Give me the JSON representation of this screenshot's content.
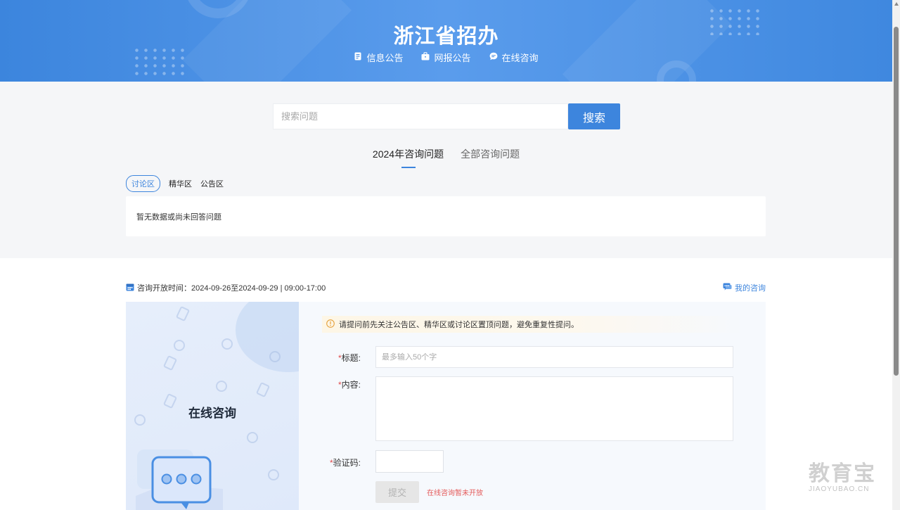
{
  "header": {
    "title": "浙江省招办",
    "nav": [
      {
        "label": "信息公告",
        "icon": "document-icon"
      },
      {
        "label": "网报公告",
        "icon": "briefcase-icon"
      },
      {
        "label": "在线咨询",
        "icon": "chat-bubble-icon"
      }
    ]
  },
  "search": {
    "placeholder": "搜索问题",
    "button_label": "搜索"
  },
  "tabs": [
    {
      "label": "2024年咨询问题",
      "active": true
    },
    {
      "label": "全部咨询问题",
      "active": false
    }
  ],
  "sections": [
    {
      "label": "讨论区",
      "active": true
    },
    {
      "label": "精华区",
      "active": false
    },
    {
      "label": "公告区",
      "active": false
    }
  ],
  "question_list": {
    "empty_text": "暂无数据或尚未回答问题"
  },
  "consult": {
    "open_time": "咨询开放时间：2024-09-26至2024-09-29 | 09:00-17:00",
    "my_consult_label": "我的咨询",
    "panel_title": "在线咨询",
    "notice": "请提问前先关注公告区、精华区或讨论区置顶问题，避免重复性提问。",
    "form": {
      "required_mark": "*",
      "title_label": "标题:",
      "title_placeholder": "最多输入50个字",
      "content_label": "内容:",
      "captcha_label": "验证码:",
      "submit_label": "提交",
      "submit_note": "在线咨询暂未开放"
    }
  },
  "watermark": {
    "main": "教育宝",
    "sub": "JIAOYUBAO.CN"
  },
  "colors": {
    "brand_blue": "#3d85dd",
    "header_gradient_mid": "#5a9cec",
    "notice_bg": "#fdf6e6",
    "required_red": "#e04b4b"
  }
}
